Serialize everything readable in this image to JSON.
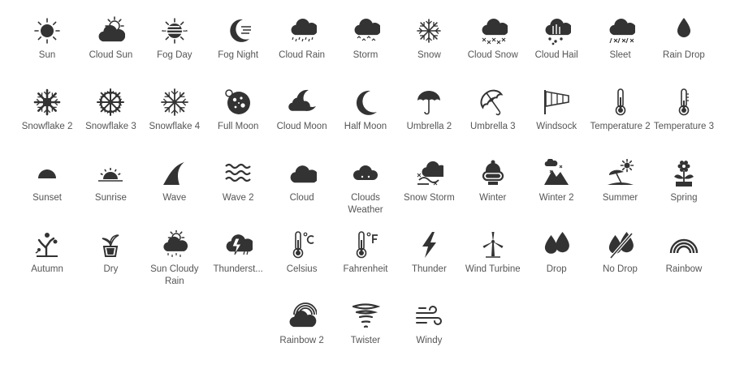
{
  "icon_color": "#333333",
  "label_color": "#555555",
  "rows": [
    [
      {
        "label": "Sun",
        "icon": "sun-icon"
      },
      {
        "label": "Cloud Sun",
        "icon": "cloud-sun-icon"
      },
      {
        "label": "Fog Day",
        "icon": "fog-day-icon"
      },
      {
        "label": "Fog Night",
        "icon": "fog-night-icon"
      },
      {
        "label": "Cloud Rain",
        "icon": "cloud-rain-icon"
      },
      {
        "label": "Storm",
        "icon": "storm-icon"
      },
      {
        "label": "Snow",
        "icon": "snow-icon"
      },
      {
        "label": "Cloud Snow",
        "icon": "cloud-snow-icon"
      },
      {
        "label": "Cloud Hail",
        "icon": "cloud-hail-icon"
      },
      {
        "label": "Sleet",
        "icon": "sleet-icon"
      },
      {
        "label": "Rain Drop",
        "icon": "rain-drop-icon"
      }
    ],
    [
      {
        "label": "Snowflake 2",
        "icon": "snowflake-2-icon"
      },
      {
        "label": "Snowflake 3",
        "icon": "snowflake-3-icon"
      },
      {
        "label": "Snowflake 4",
        "icon": "snowflake-4-icon"
      },
      {
        "label": "Full Moon",
        "icon": "full-moon-icon"
      },
      {
        "label": "Cloud Moon",
        "icon": "cloud-moon-icon"
      },
      {
        "label": "Half Moon",
        "icon": "half-moon-icon"
      },
      {
        "label": "Umbrella 2",
        "icon": "umbrella-2-icon"
      },
      {
        "label": "Umbrella 3",
        "icon": "umbrella-3-icon"
      },
      {
        "label": "Windsock",
        "icon": "windsock-icon"
      },
      {
        "label": "Temperature 2",
        "icon": "temperature-2-icon"
      },
      {
        "label": "Temperature 3",
        "icon": "temperature-3-icon"
      }
    ],
    [
      {
        "label": "Sunset",
        "icon": "sunset-icon"
      },
      {
        "label": "Sunrise",
        "icon": "sunrise-icon"
      },
      {
        "label": "Wave",
        "icon": "wave-icon"
      },
      {
        "label": "Wave 2",
        "icon": "wave-2-icon"
      },
      {
        "label": "Cloud",
        "icon": "cloud-icon"
      },
      {
        "label": "Clouds Weather",
        "icon": "clouds-weather-icon"
      },
      {
        "label": "Snow Storm",
        "icon": "snow-storm-icon"
      },
      {
        "label": "Winter",
        "icon": "winter-icon"
      },
      {
        "label": "Winter 2",
        "icon": "winter-2-icon"
      },
      {
        "label": "Summer",
        "icon": "summer-icon"
      },
      {
        "label": "Spring",
        "icon": "spring-icon"
      }
    ],
    [
      {
        "label": "Autumn",
        "icon": "autumn-icon"
      },
      {
        "label": "Dry",
        "icon": "dry-icon"
      },
      {
        "label": "Sun Cloudy Rain",
        "icon": "sun-cloudy-rain-icon"
      },
      {
        "label": "Thunderst...",
        "icon": "thunderstorm-icon"
      },
      {
        "label": "Celsius",
        "icon": "celsius-icon"
      },
      {
        "label": "Fahrenheit",
        "icon": "fahrenheit-icon"
      },
      {
        "label": "Thunder",
        "icon": "thunder-icon"
      },
      {
        "label": "Wind Turbine",
        "icon": "wind-turbine-icon"
      },
      {
        "label": "Drop",
        "icon": "drop-icon"
      },
      {
        "label": "No Drop",
        "icon": "no-drop-icon"
      },
      {
        "label": "Rainbow",
        "icon": "rainbow-icon"
      }
    ],
    [
      {
        "label": "Rainbow 2",
        "icon": "rainbow-2-icon"
      },
      {
        "label": "Twister",
        "icon": "twister-icon"
      },
      {
        "label": "Windy",
        "icon": "windy-icon"
      }
    ]
  ]
}
